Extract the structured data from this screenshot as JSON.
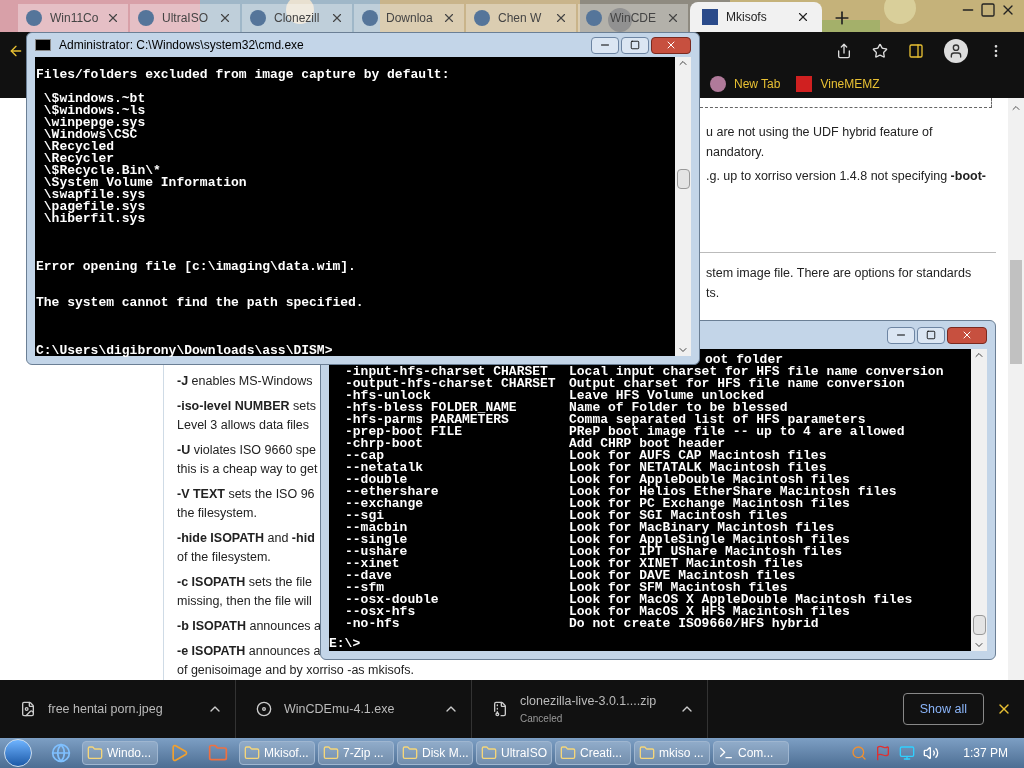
{
  "browser": {
    "tabs": [
      {
        "title": "Win11Co",
        "selected": false
      },
      {
        "title": "UltraISO",
        "selected": false
      },
      {
        "title": "Clonezill",
        "selected": false
      },
      {
        "title": "Downloa",
        "selected": false
      },
      {
        "title": "Chen W",
        "selected": false
      },
      {
        "title": "WinCDE",
        "selected": false
      },
      {
        "title": "Mkisofs",
        "selected": true
      }
    ],
    "bookmarks": [
      {
        "label": "New Tab"
      },
      {
        "label": "VineMEMZ"
      }
    ],
    "article": {
      "right_lines": [
        {
          "text": "u are not using the UDF hybrid feature of"
        },
        {
          "text": "nandatory."
        },
        {
          "text": ".g. up to xorriso version 1.4.8 not specifying **-boot-**"
        },
        {
          "text": "stem image file. There are options for standards"
        },
        {
          "text": "ts."
        }
      ],
      "left_paragraphs": [
        [
          "**-J** enables MS-Windows"
        ],
        [
          "**-iso-level NUMBER** sets",
          "Level 3 allows data files"
        ],
        [
          "**-U** violates ISO 9660 spe",
          "this is a cheap way to get"
        ],
        [
          "**-V TEXT** sets the ISO 96",
          "the filesystem."
        ],
        [
          "**-hide ISOPATH** and **-hid**",
          "of the filesystem."
        ],
        [
          "**-c ISOPATH** sets the file",
          "missing, then the file will"
        ],
        [
          "**-b ISOPATH** announces a"
        ],
        [
          "**-e ISOPATH** announces a",
          "of genisoimage and by xorriso -as mkisofs."
        ]
      ]
    },
    "downloads": {
      "items": [
        {
          "name": "free hentai porn.jpeg"
        },
        {
          "name": "WinCDEmu-4.1.exe"
        },
        {
          "name": "clonezilla-live-3.0.1....zip",
          "status": "Canceled"
        }
      ],
      "show_all": "Show all"
    }
  },
  "cmd_window": {
    "title": "Administrator: C:\\Windows\\system32\\cmd.exe",
    "blocks": [
      [
        "Files/folders excluded from image capture by default:"
      ],
      [
        " \\$windows.~bt",
        " \\$windows.~ls",
        " \\winpepge.sys",
        " \\Windows\\CSC",
        " \\Recycled",
        " \\Recycler",
        " \\$Recycle.Bin\\*",
        " \\System Volume Information",
        " \\swapfile.sys",
        " \\pagefile.sys",
        " \\hiberfil.sys"
      ],
      [
        "Error opening file [c:\\imaging\\data.wim]."
      ],
      [
        "The system cannot find the path specified."
      ],
      [
        "C:\\Users\\digibrony\\Downloads\\ass\\DISM>"
      ]
    ]
  },
  "console_window": {
    "rows": [
      {
        "kind": "partial",
        "description": "oot folder"
      },
      {
        "option": "-input-hfs-charset CHARSET",
        "description": "Local input charset for HFS file name conversion"
      },
      {
        "option": "-output-hfs-charset CHARSET",
        "description": "Output charset for HFS file name conversion"
      },
      {
        "option": "-hfs-unlock",
        "description": "Leave HFS Volume unlocked"
      },
      {
        "option": "-hfs-bless FOLDER_NAME",
        "description": "Name of Folder to be blessed"
      },
      {
        "option": "-hfs-parms PARAMETERS",
        "description": "Comma separated list of HFS parameters"
      },
      {
        "option": "-prep-boot FILE",
        "description": "PReP boot image file -- up to 4 are allowed"
      },
      {
        "option": "-chrp-boot",
        "description": "Add CHRP boot header"
      },
      {
        "option": "--cap",
        "description": "Look for AUFS CAP Macintosh files"
      },
      {
        "option": "--netatalk",
        "description": "Look for NETATALK Macintosh files"
      },
      {
        "option": "--double",
        "description": "Look for AppleDouble Macintosh files"
      },
      {
        "option": "--ethershare",
        "description": "Look for Helios EtherShare Macintosh files"
      },
      {
        "option": "--exchange",
        "description": "Look for PC Exchange Macintosh files"
      },
      {
        "option": "--sgi",
        "description": "Look for SGI Macintosh files"
      },
      {
        "option": "--macbin",
        "description": "Look for MacBinary Macintosh files"
      },
      {
        "option": "--single",
        "description": "Look for AppleSingle Macintosh files"
      },
      {
        "option": "--ushare",
        "description": "Look for IPT UShare Macintosh files"
      },
      {
        "option": "--xinet",
        "description": "Look for XINET Macintosh files"
      },
      {
        "option": "--dave",
        "description": "Look for DAVE Macintosh files"
      },
      {
        "option": "--sfm",
        "description": "Look for SFM Macintosh files"
      },
      {
        "option": "--osx-double",
        "description": "Look for MacOS X AppleDouble Macintosh files"
      },
      {
        "option": "--osx-hfs",
        "description": "Look for MacOS X HFS Macintosh files"
      },
      {
        "option": "-no-hfs",
        "description": "Do not create ISO9660/HFS hybrid"
      }
    ],
    "prompt": "E:\\>"
  },
  "taskbar": {
    "items": [
      {
        "label": "Windo..."
      },
      {
        "label": "Mkisof..."
      },
      {
        "label": "7-Zip ..."
      },
      {
        "label": "Disk M..."
      },
      {
        "label": "UltraISO"
      },
      {
        "label": "Creati..."
      },
      {
        "label": "mkiso ..."
      },
      {
        "label": "Com..."
      }
    ],
    "clock": "1:37 PM"
  }
}
